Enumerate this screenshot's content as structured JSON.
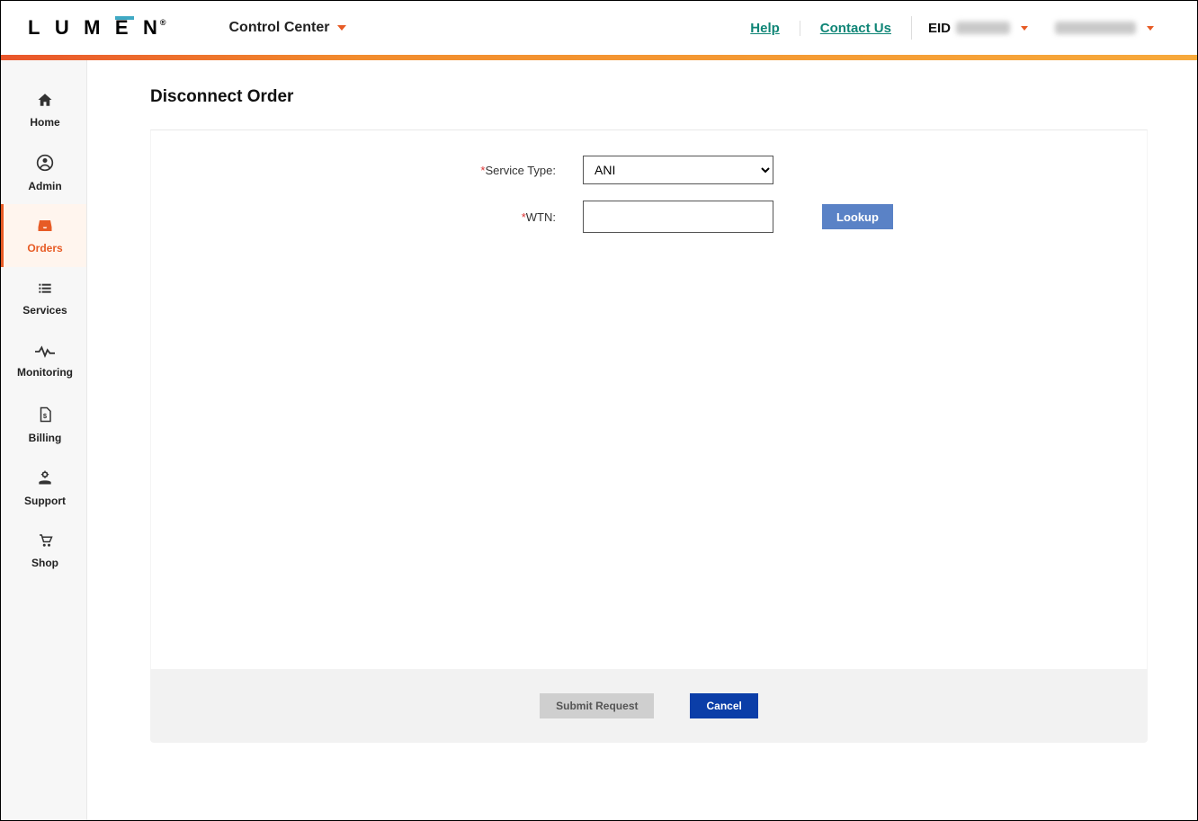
{
  "header": {
    "brand": "LUMEN",
    "control_center_label": "Control Center",
    "help_label": "Help",
    "contact_label": "Contact Us",
    "eid_prefix": "EID"
  },
  "sidebar": {
    "items": [
      {
        "label": "Home"
      },
      {
        "label": "Admin"
      },
      {
        "label": "Orders"
      },
      {
        "label": "Services"
      },
      {
        "label": "Monitoring"
      },
      {
        "label": "Billing"
      },
      {
        "label": "Support"
      },
      {
        "label": "Shop"
      }
    ]
  },
  "page": {
    "title": "Disconnect Order"
  },
  "form": {
    "service_type_label": "Service Type:",
    "service_type_value": "ANI",
    "wtn_label": "WTN:",
    "wtn_value": "",
    "lookup_label": "Lookup"
  },
  "footer": {
    "submit_label": "Submit Request",
    "cancel_label": "Cancel"
  }
}
